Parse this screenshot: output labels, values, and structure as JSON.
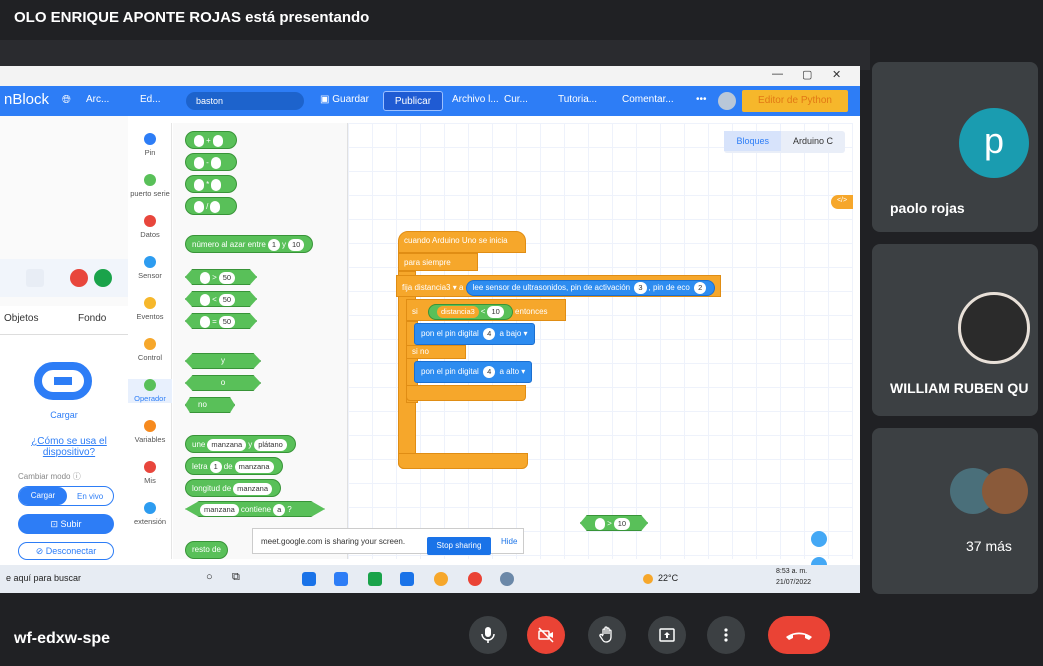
{
  "presenter_banner": "OLO ENRIQUE APONTE ROJAS está presentando",
  "app": {
    "name": "nBlock",
    "menu": [
      "Arc...",
      "Ed..."
    ],
    "project_name": "baston",
    "guardar": "Guardar",
    "publicar": "Publicar",
    "more_menu": [
      "Archivo l...",
      "Cur...",
      "Tutoria...",
      "Comentar...",
      "•••"
    ],
    "python_editor": "Editor de Python"
  },
  "window_controls": [
    "—",
    "▢",
    "✕"
  ],
  "left_panel": {
    "tabs": [
      "Objetos",
      "Fondo"
    ],
    "device_label": "Cargar",
    "how_to": "¿Cómo se usa el dispositivo?",
    "mode_label": "Cambiar modo ⓘ",
    "mode_options": [
      "Cargar",
      "En vivo"
    ],
    "upload": "Subir",
    "disconnect": "Desconectar"
  },
  "categories": [
    {
      "label": "Pin",
      "color": "#2d7df6"
    },
    {
      "label": "puerto serie",
      "color": "#59c059"
    },
    {
      "label": "Datos",
      "color": "#e8463c"
    },
    {
      "label": "Sensor",
      "color": "#2d9cf0"
    },
    {
      "label": "Eventos",
      "color": "#f6b72b"
    },
    {
      "label": "Control",
      "color": "#f6a72b"
    },
    {
      "label": "Operador",
      "color": "#59c059"
    },
    {
      "label": "Variables",
      "color": "#f68a1e"
    },
    {
      "label": "Mis",
      "color": "#e8463c"
    },
    {
      "label": "extensión",
      "color": "#2d9cf0"
    }
  ],
  "palette": {
    "ops": [
      "+",
      "-",
      "*",
      "/"
    ],
    "random": {
      "text": "número al azar entre",
      "a": "1",
      "mid": "y",
      "b": "10"
    },
    "compare": [
      {
        "op": ">",
        "val": "50"
      },
      {
        "op": "<",
        "val": "50"
      },
      {
        "op": "=",
        "val": "50"
      }
    ],
    "logic": [
      "y",
      "o",
      "no"
    ],
    "join": {
      "text": "une",
      "a": "manzana",
      "mid": "y",
      "b": "plátano"
    },
    "letter": {
      "text": "letra",
      "n": "1",
      "de": "de",
      "s": "manzana"
    },
    "length": {
      "text": "longitud de",
      "s": "manzana"
    },
    "contains": {
      "s": "manzana",
      "text": "contiene",
      "c": "a",
      "q": "?"
    },
    "mod": "resto de"
  },
  "workspace": {
    "tabs": [
      "Bloques",
      "Arduino C"
    ],
    "code_tag": "</>",
    "hat": "cuando Arduino Uno se inicia",
    "forever": "para siempre",
    "set": {
      "text": "fija",
      "var": "distancia3 ▾",
      "a": "a",
      "sensor": "lee sensor de ultrasonidos, pin de activación",
      "trig": "3",
      "echo_lbl": ", pin de eco",
      "echo": "2"
    },
    "if": {
      "si": "si",
      "var": "distancia3",
      "op": "<",
      "val": "10",
      "entonces": "entonces"
    },
    "then": {
      "text": "pon el pin digital",
      "pin": "4",
      "a": "a",
      "state": "bajo ▾"
    },
    "else_label": "si no",
    "else": {
      "text": "pon el pin digital",
      "pin": "4",
      "a": "a",
      "state": "alto ▾"
    },
    "loose": {
      "op": ">",
      "val": "10"
    }
  },
  "share_bar": {
    "text": "meet.google.com is sharing your screen.",
    "stop": "Stop sharing",
    "hide": "Hide"
  },
  "taskbar": {
    "search": "e aquí para buscar",
    "weather": "22°C",
    "time": "8:53 a. m.",
    "date": "21/07/2022"
  },
  "participants": [
    {
      "name": "paolo rojas",
      "initial": "p",
      "color": "#1a9cb0"
    },
    {
      "name": "WILLIAM RUBEN QU"
    },
    {
      "name": "37 más"
    }
  ],
  "meeting_code": "wf-edxw-spe",
  "controls": [
    "mic",
    "camera-off",
    "raise-hand",
    "present",
    "more",
    "leave"
  ]
}
